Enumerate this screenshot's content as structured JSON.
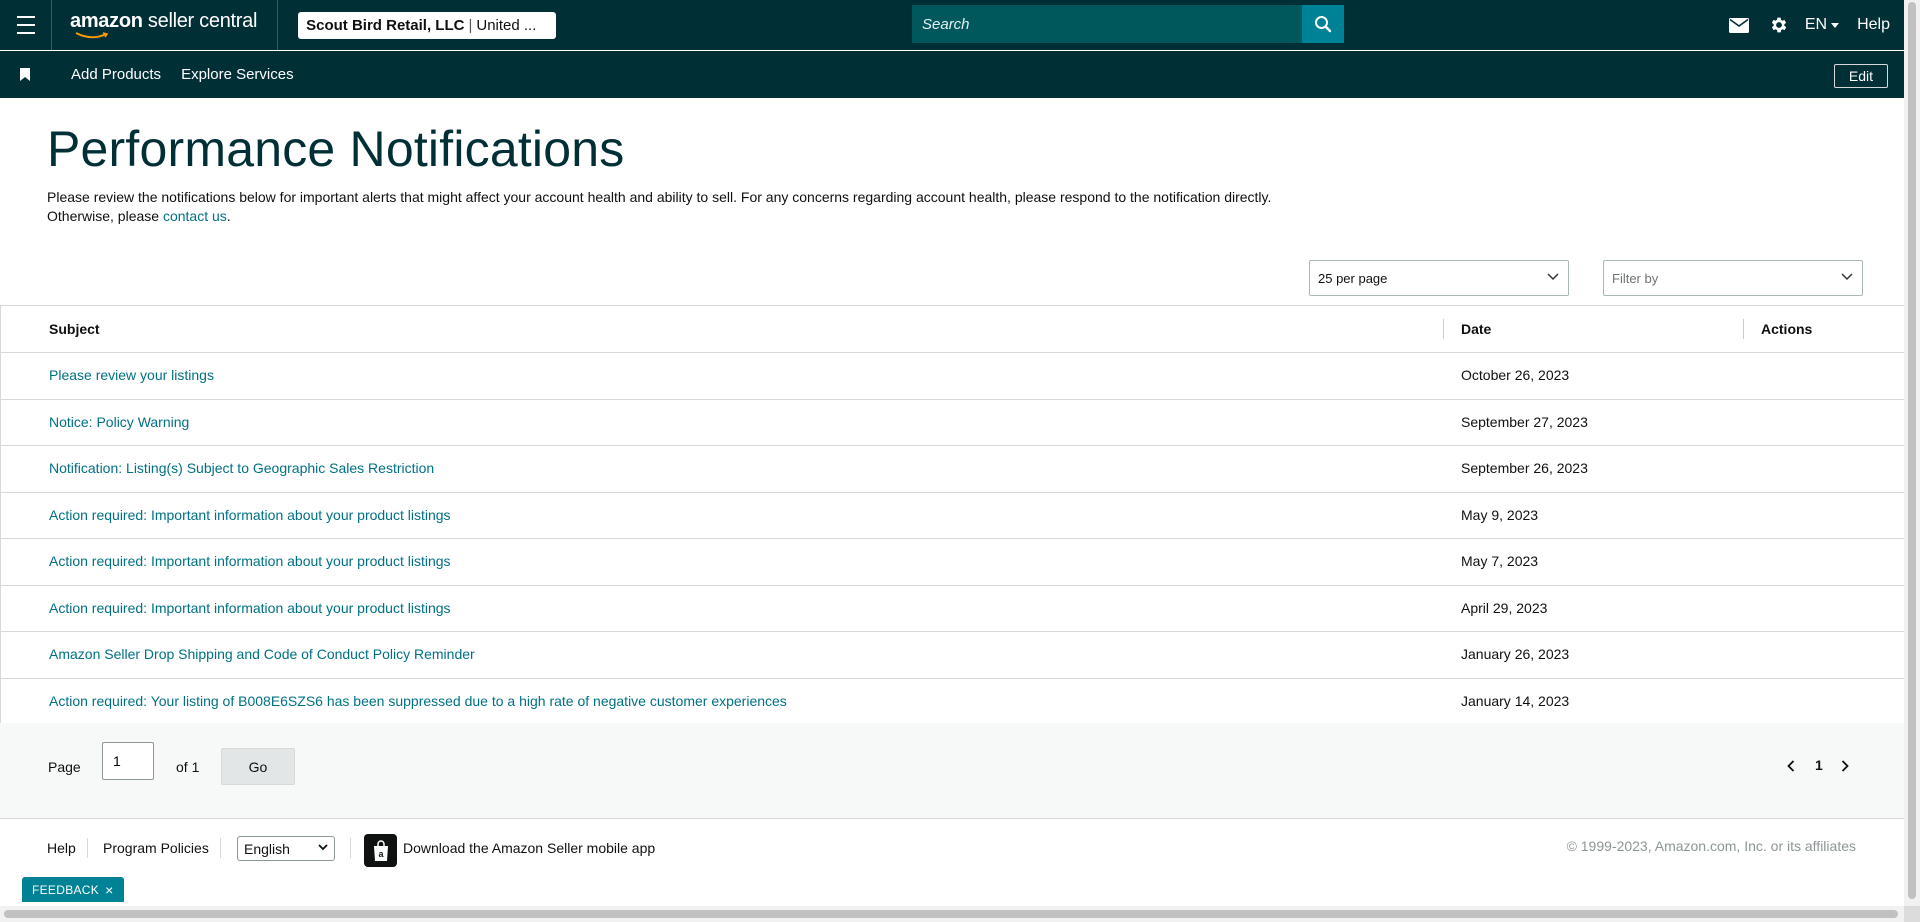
{
  "topbar": {
    "logo_main": "amazon",
    "logo_sub": " seller central",
    "account_name": "Scout Bird Retail, LLC",
    "account_separator": "|",
    "account_marketplace": "United ...",
    "search_placeholder": "Search",
    "language": "EN",
    "help": "Help",
    "icons": [
      "menu-icon",
      "mail-icon",
      "gear-icon",
      "search-icon",
      "caret-down-icon"
    ]
  },
  "subbar": {
    "links": [
      "Add Products",
      "Explore Services"
    ],
    "edit_label": "Edit"
  },
  "page": {
    "title": "Performance Notifications",
    "intro_text": "Please review the notifications below for important alerts that might affect your account health and ability to sell. For any concerns regarding account health, please respond to the notification directly. Otherwise, please ",
    "contact_link": "contact us",
    "intro_end": "."
  },
  "controls": {
    "per_page": "25 per page",
    "filter_placeholder": "Filter by"
  },
  "table": {
    "columns": [
      "Subject",
      "Date",
      "Actions"
    ],
    "rows": [
      {
        "subject": "Please review your listings",
        "date": "October 26, 2023"
      },
      {
        "subject": "Notice: Policy Warning",
        "date": "September 27, 2023"
      },
      {
        "subject": "Notification: Listing(s) Subject to Geographic Sales Restriction",
        "date": "September 26, 2023"
      },
      {
        "subject": "Action required: Important information about your product listings",
        "date": "May 9, 2023"
      },
      {
        "subject": "Action required: Important information about your product listings",
        "date": "May 7, 2023"
      },
      {
        "subject": "Action required: Important information about your product listings",
        "date": "April 29, 2023"
      },
      {
        "subject": "Amazon Seller Drop Shipping and Code of Conduct Policy Reminder",
        "date": "January 26, 2023"
      },
      {
        "subject": "Action required: Your listing of B008E6SZS6 has been suppressed due to a high rate of negative customer experiences",
        "date": "January 14, 2023"
      }
    ]
  },
  "pagination": {
    "page_label": "Page",
    "page_value": "1",
    "of_label": "of 1",
    "go_label": "Go",
    "current_page": "1"
  },
  "footer": {
    "help": "Help",
    "policies": "Program Policies",
    "language": "English",
    "app_text": "Download the Amazon Seller mobile app",
    "copyright": "© 1999-2023, Amazon.com, Inc. or its affiliates"
  },
  "feedback": {
    "label": "FEEDBACK",
    "close": "×"
  },
  "colors": {
    "nav_bg": "#002f36",
    "search_bg": "#00575c",
    "accent": "#008296",
    "link": "#007185"
  }
}
